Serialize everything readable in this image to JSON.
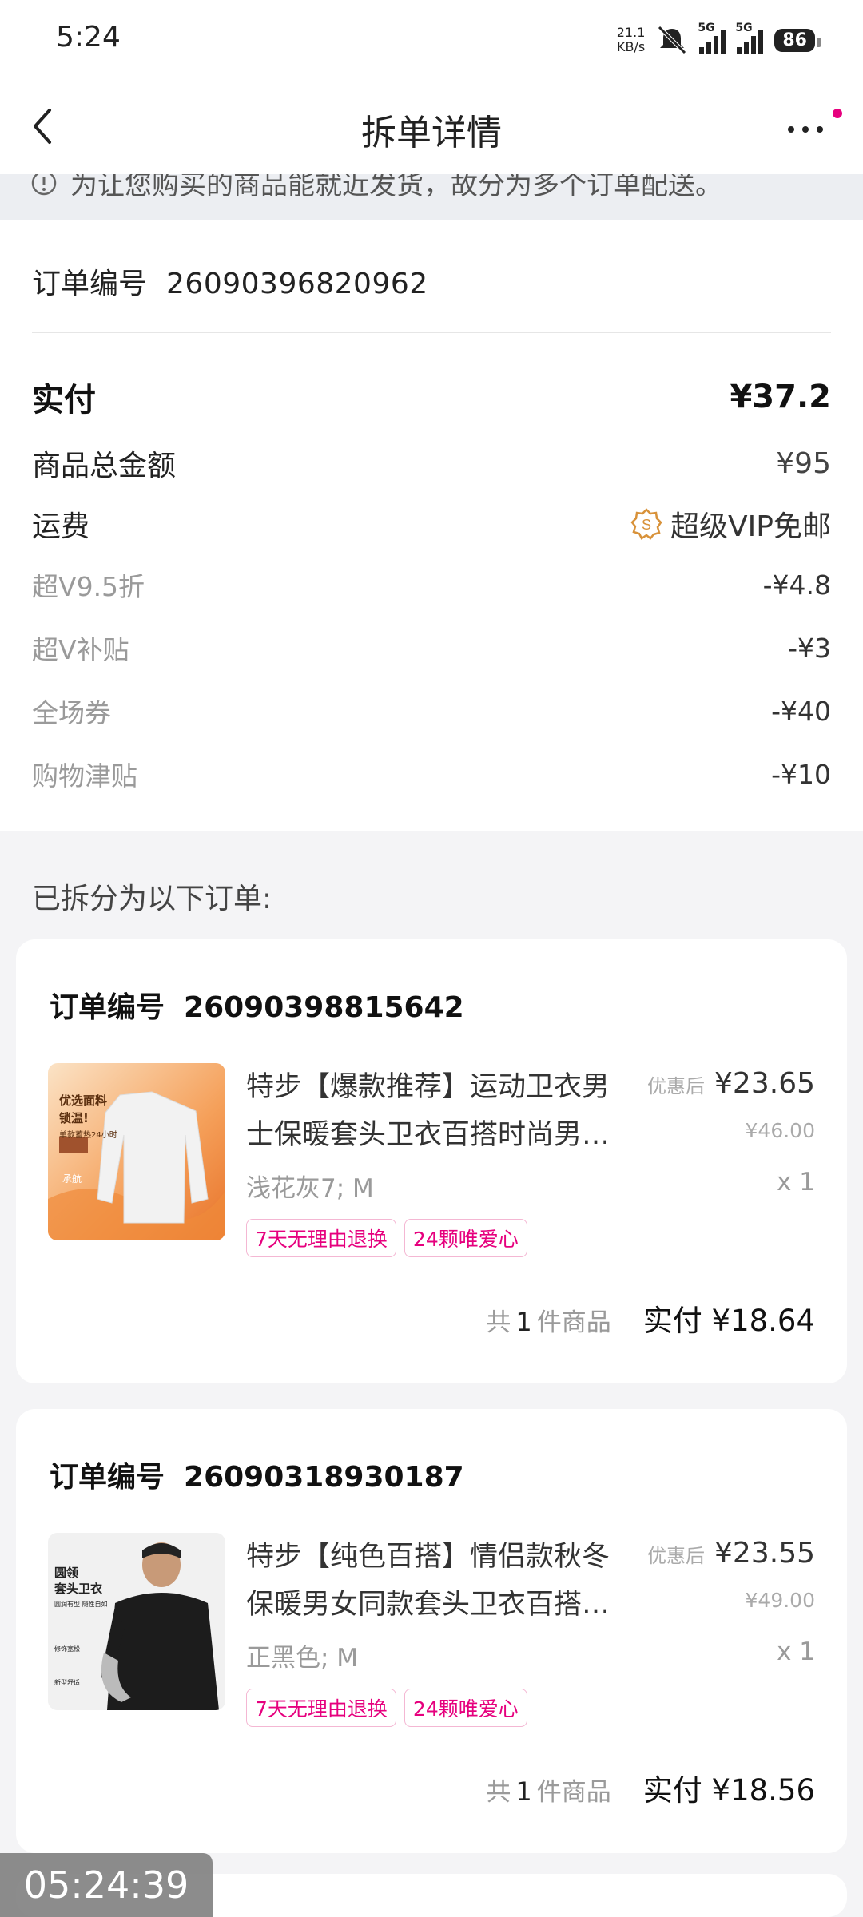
{
  "status_bar": {
    "time": "5:24",
    "net_speed_value": "21.1",
    "net_speed_unit": "KB/s",
    "sim1_label": "5G",
    "sim2_label": "5G",
    "battery": "86",
    "icons": [
      "mute-icon",
      "signal-icon",
      "signal-icon",
      "battery-icon"
    ]
  },
  "header": {
    "title": "拆单详情",
    "back_icon": "chevron-left-icon",
    "more_icon": "more-dots-icon",
    "notification_dot_color": "#e6007e"
  },
  "notice": {
    "icon": "info-icon",
    "text": "为让您购买的商品能就近发货，故分为多个订单配送。"
  },
  "summary": {
    "order_label": "订单编号",
    "order_number": "26090396820962",
    "rows": [
      {
        "label": "实付",
        "value": "¥37.2"
      },
      {
        "label": "商品总金额",
        "value": "¥95"
      },
      {
        "label": "运费",
        "value": "超级VIP免邮"
      },
      {
        "label": "超V9.5折",
        "value": "-¥4.8"
      },
      {
        "label": "超V补贴",
        "value": "-¥3"
      },
      {
        "label": "全场券",
        "value": "-¥40"
      },
      {
        "label": "购物津贴",
        "value": "-¥10"
      }
    ]
  },
  "split_title": "已拆分为以下订单:",
  "orders": [
    {
      "order_label": "订单编号",
      "order_number": "26090398815642",
      "name_line1": "特步【爆款推荐】运动卫衣男",
      "name_line2": "士保暖套头卫衣百搭时尚男…",
      "price_tag": "优惠后",
      "price": "¥23.65",
      "original_price": "¥46.00",
      "spec": "浅花灰7; M",
      "qty": "x 1",
      "badges": [
        "7天无理由退换",
        "24颗唯爱心"
      ],
      "count_prefix": "共",
      "count": "1",
      "count_suffix": "件商品",
      "paid": "实付 ¥18.64",
      "thumb_text": {
        "line1": "优选面料",
        "line2": "锁温!",
        "line3": "单款蓄热24小时",
        "tag": "承航"
      }
    },
    {
      "order_label": "订单编号",
      "order_number": "26090318930187",
      "name_line1": "特步【纯色百搭】情侣款秋冬",
      "name_line2": "保暖男女同款套头卫衣百搭…",
      "price_tag": "优惠后",
      "price": "¥23.55",
      "original_price": "¥49.00",
      "spec": "正黑色; M",
      "qty": "x 1",
      "badges": [
        "7天无理由退换",
        "24颗唯爱心"
      ],
      "count_prefix": "共",
      "count": "1",
      "count_suffix": "件商品",
      "paid": "实付 ¥18.56",
      "thumb_text": {
        "line1": "圆领",
        "line2": "套头卫衣",
        "line3": "圆润有型 随性自如",
        "f1": "修饰宽松",
        "f2": "",
        "f3": "新型舒适"
      }
    }
  ],
  "overlay_timer": "05:24:39",
  "colors": {
    "accent": "#e6007e",
    "badge_border": "#f4b7d3",
    "vip_icon": "#d8923a"
  }
}
